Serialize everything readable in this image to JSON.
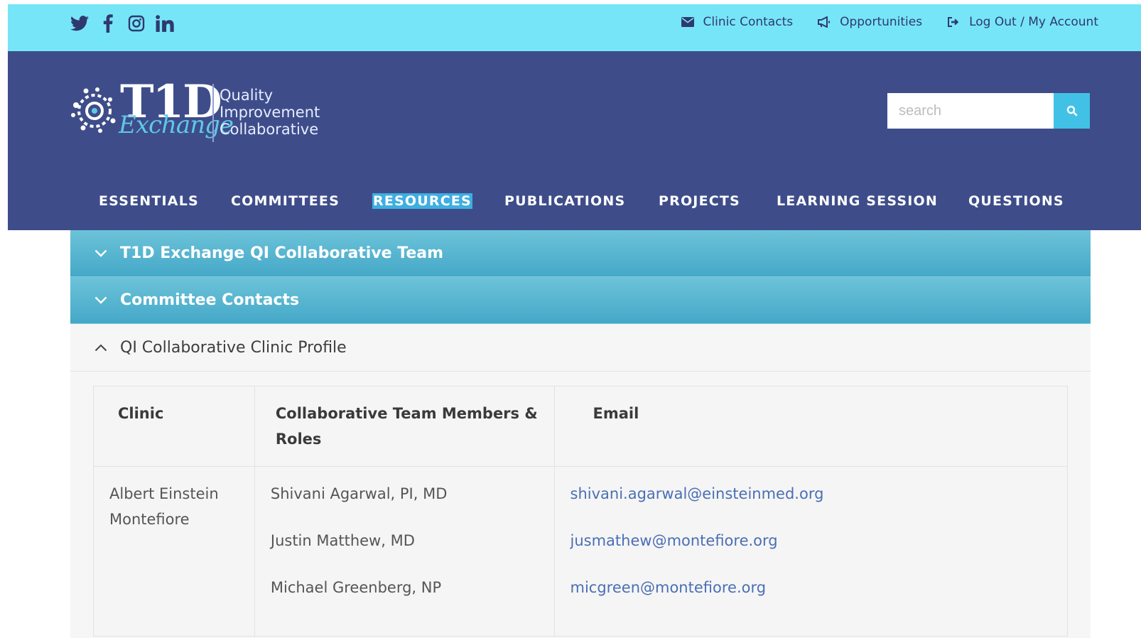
{
  "topbar": {
    "social": [
      {
        "icon": "twitter-icon"
      },
      {
        "icon": "facebook-icon"
      },
      {
        "icon": "instagram-icon"
      },
      {
        "icon": "linkedin-icon"
      }
    ],
    "links": [
      {
        "icon": "envelope-icon",
        "label": "Clinic Contacts"
      },
      {
        "icon": "megaphone-icon",
        "label": "Opportunities"
      },
      {
        "icon": "sign-out-icon",
        "label": "Log Out / My Account"
      }
    ]
  },
  "header": {
    "logo": {
      "mark": "T1D",
      "script": "Exchange",
      "tagline": [
        "Quality",
        "Improvement",
        "Collaborative"
      ]
    },
    "search": {
      "placeholder": "search",
      "button_icon": "search-icon"
    },
    "nav": [
      "ESSENTIALS",
      "COMMITTEES",
      "RESOURCES",
      "PUBLICATIONS",
      "PROJECTS",
      "LEARNING SESSION",
      "QUESTIONS"
    ],
    "nav_active": "RESOURCES"
  },
  "accordion": {
    "sections": [
      {
        "title": "T1D Exchange QI Collaborative Team",
        "open": false
      },
      {
        "title": "Committee Contacts",
        "open": false
      },
      {
        "title": "QI Collaborative Clinic Profile",
        "open": true
      }
    ],
    "table": {
      "headers": {
        "clinic": "Clinic",
        "members": "Collaborative Team Members & Roles",
        "email": "Email"
      },
      "clinic": [
        "Albert Einstein",
        "Montefiore"
      ],
      "members": [
        "Shivani Agarwal, PI, MD",
        "Justin Matthew, MD",
        "Michael Greenberg, NP"
      ],
      "emails": [
        "shivani.agarwal@einsteinmed.org",
        "jusmathew@montefiore.org",
        "micgreen@montefiore.org"
      ]
    }
  },
  "colors": {
    "topbar_bg": "#77e5f8",
    "header_bg": "#3e4d8a",
    "accordion_bg": "#45a8c8",
    "link": "#4a6fb5"
  }
}
